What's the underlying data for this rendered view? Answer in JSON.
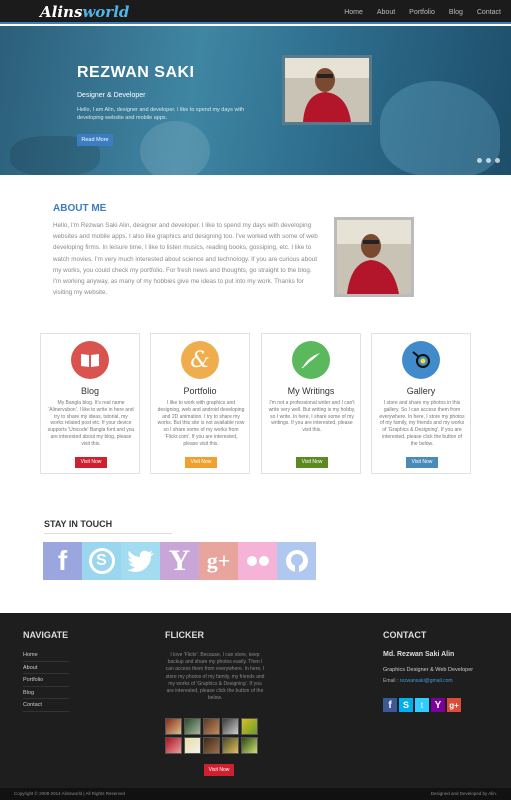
{
  "header": {
    "logo_part1": "Alins",
    "logo_part2": "world",
    "nav": [
      "Home",
      "About",
      "Portfolio",
      "Blog",
      "Contact"
    ]
  },
  "hero": {
    "title": "REZWAN SAKI",
    "subtitle": "Designer & Developer",
    "text": "Hello, I am Alin, designer and developer. I like to spend my days with developing website and mobile apps.",
    "button": "Read More"
  },
  "about": {
    "title": "ABOUT ME",
    "text": "Hello, I'm Rezwan Saki Alin, designer and developer. I like to spend my days with developing websites and mobile apps. I also like graphics and designing too. I've worked with some of web developing firms. In leisure time, I like to listen musics, reading books, gossiping, etc. I like to watch movies. I'm very much interested about science and technology. If you are curious about my works, you could check my portfolio. For fresh news and thoughts, go straight to the blog. I'm working anyway, as many of my hobbies give me ideas to put into my work. Thanks for visiting my website."
  },
  "services": [
    {
      "title": "Blog",
      "desc": "My Bangla blog. It's real name 'Alinervubon'. I like to write in here and try to share my ideas, tutorial, my works related post etc. If your device supports 'Unicode' Bangla font and you are interested about my blog, please visit this.",
      "button": "Visit Now",
      "color": "#d9534f",
      "btn_color": "#cf2030"
    },
    {
      "title": "Portfolio",
      "desc": "I like to work with graphics and designing, web and android developing and 2D animation. I try to share my works. But this site is not available now so I share some of my works from 'Flickr.com'. If you are interested, please visit this.",
      "button": "Visit Now",
      "color": "#f0ad4e",
      "btn_color": "#f0a030"
    },
    {
      "title": "My Writings",
      "desc": "I'm not a professional writer and I can't write very well. But writing is my hobby, so I write. In here, I share some of my writings. If you are interested, please visit this.",
      "button": "Visit Now",
      "color": "#5cb85c",
      "btn_color": "#5a8a20"
    },
    {
      "title": "Gallery",
      "desc": "I store and share my photos in this gallery. So I can access them from everywhere. In here, I store my photos of my family, my friends and my works of 'Graphics & Designing'. If you are interested, please click the button of the below.",
      "button": "Visit Now",
      "color": "#428bca",
      "btn_color": "#4a8ab8"
    }
  ],
  "stay_in_touch": {
    "title": "STAY IN TOUCH",
    "icons": [
      {
        "name": "facebook-icon",
        "glyph": "f",
        "bg": "#9aa6dd"
      },
      {
        "name": "skype-icon",
        "glyph": "S",
        "bg": "#9ad6ee"
      },
      {
        "name": "twitter-icon",
        "glyph": "🐦",
        "bg": "#a3dcf0"
      },
      {
        "name": "yahoo-icon",
        "glyph": "Y",
        "bg": "#c8a6d8"
      },
      {
        "name": "google-plus-icon",
        "glyph": "g+",
        "bg": "#e7a59e"
      },
      {
        "name": "flickr-icon",
        "glyph": "••",
        "bg": "#f5b3d8"
      },
      {
        "name": "github-icon",
        "glyph": "⌬",
        "bg": "#b0c8f0"
      }
    ]
  },
  "footer": {
    "navigate_title": "NAVIGATE",
    "nav_links": [
      "Home",
      "About",
      "Portfolio",
      "Blog",
      "Contact"
    ],
    "flickr_title": "FLICKER",
    "flickr_text": "I love 'Flickr'. Because, I can store, keep backup and share my photos easily. Then I can access them from everywhere. In here, I store my photos of my family, my friends and my works of 'Graphics & Designing'. If you are interested, please click the button of the below.",
    "flickr_button": "Visit Now",
    "contact_title": "CONTACT",
    "contact_name": "Md. Rezwan Saki Alin",
    "contact_role": "Graphics Designer & Web Developer",
    "email_label": "Email : ",
    "email_value": "rezwansaki@gmail.com",
    "copyright": "Copyright © 2008-2014 Alinsworld | All Rights Reserved",
    "credit": "Designed and Developed by Alin."
  }
}
